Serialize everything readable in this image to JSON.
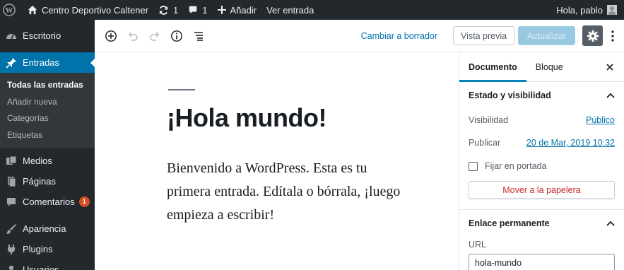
{
  "adminbar": {
    "site_name": "Centro Deportivo Caltener",
    "updates_count": "1",
    "comments_count": "1",
    "new_label": "Añadir",
    "view_post_label": "Ver entrada",
    "greeting": "Hola, pablo"
  },
  "menu": {
    "dashboard": "Escritorio",
    "posts": "Entradas",
    "posts_sub": [
      "Todas las entradas",
      "Añadir nueva",
      "Categorías",
      "Etiquetas"
    ],
    "media": "Medios",
    "pages": "Páginas",
    "comments": "Comentarios",
    "comments_badge": "1",
    "appearance": "Apariencia",
    "plugins": "Plugins",
    "users": "Usuarios"
  },
  "toolbar": {
    "switch_to_draft": "Cambiar a borrador",
    "preview": "Vista previa",
    "update": "Actualizar"
  },
  "post": {
    "title": "¡Hola mundo!",
    "body": "Bienvenido a WordPress. Esta es tu primera entrada. Edítala o bórrala, ¡luego empieza a escribir!"
  },
  "sidebar": {
    "tabs": [
      "Documento",
      "Bloque"
    ],
    "status_panel": {
      "title": "Estado y visibilidad",
      "visibility_label": "Visibilidad",
      "visibility_value": "Público",
      "publish_label": "Publicar",
      "publish_value": "20 de Mar, 2019 10:32",
      "sticky_label": "Fijar en portada",
      "sticky_checked": false,
      "trash_label": "Mover a la papelera"
    },
    "permalink_panel": {
      "title": "Enlace permanente",
      "url_label": "URL",
      "url_value": "hola-mundo"
    }
  },
  "colors": {
    "adminbar_bg": "#23282d",
    "menu_current": "#0073aa",
    "link": "#0073aa",
    "trash": "#c92c2c",
    "tab_indicator": "#0085ba"
  }
}
